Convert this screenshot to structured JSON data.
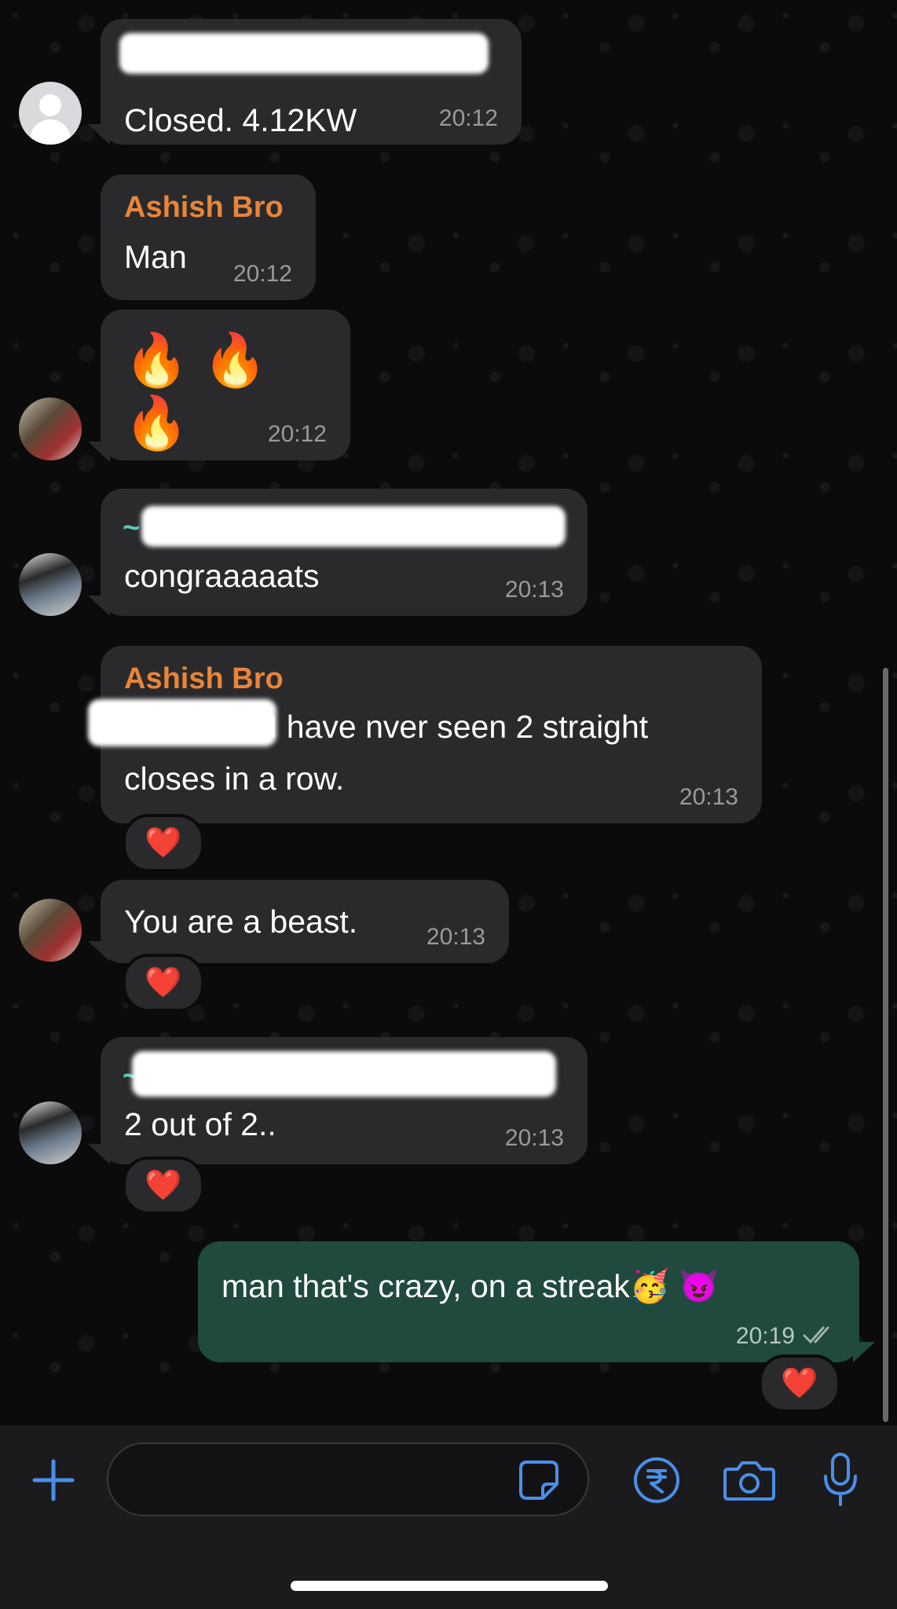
{
  "messages": [
    {
      "id": "m1",
      "sender": "",
      "text": "Closed. 4.12KW",
      "time": "20:12",
      "avatar": "default-avatar"
    },
    {
      "id": "m2",
      "sender": "Ashish Bro",
      "text": "Man",
      "time": "20:12"
    },
    {
      "id": "m3",
      "sender": "",
      "text": "🔥🔥🔥",
      "time": "20:12",
      "avatar": "photo-avatar-1"
    },
    {
      "id": "m4",
      "sender": "~",
      "text": "congraaaaats",
      "time": "20:13",
      "avatar": "photo-avatar-2"
    },
    {
      "id": "m5",
      "sender": "Ashish Bro",
      "text_line1": "I have nver seen 2 straight",
      "text_line2": "closes in a row.",
      "time": "20:13",
      "reaction": "❤️"
    },
    {
      "id": "m6",
      "sender": "",
      "text": "You are a beast.",
      "time": "20:13",
      "avatar": "photo-avatar-1",
      "reaction": "❤️"
    },
    {
      "id": "m7",
      "sender": "~",
      "text": "2 out of 2..",
      "time": "20:13",
      "avatar": "photo-avatar-2",
      "reaction": "❤️"
    },
    {
      "id": "m8",
      "outgoing": true,
      "text": "man that's crazy, on a streak🥳 😈",
      "time": "20:19",
      "status": "read-double-check",
      "reaction": "❤️"
    }
  ],
  "input_bar": {
    "placeholder": "",
    "icons": [
      "plus-icon",
      "sticker-icon",
      "rupee-payment-icon",
      "camera-icon",
      "microphone-icon"
    ]
  },
  "colors": {
    "incoming_bubble": "#2a2a2c",
    "outgoing_bubble": "#1f4a3d",
    "sender_name": "#e8853a",
    "icon_accent": "#4a8fe8",
    "background": "#0b0b0b"
  }
}
